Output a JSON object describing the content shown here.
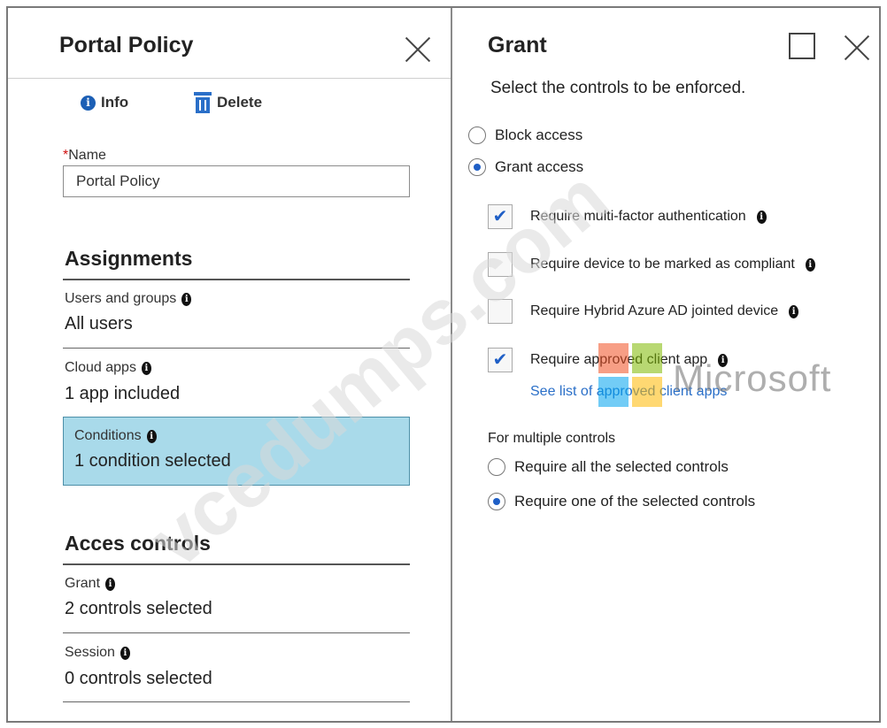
{
  "left": {
    "title": "Portal Policy",
    "toolbar": {
      "info_label": "Info",
      "delete_label": "Delete"
    },
    "name": {
      "required_mark": "*",
      "label": "Name",
      "value": "Portal Policy"
    },
    "assignments": {
      "title": "Assignments",
      "users_groups": {
        "label": "Users and groups",
        "value": "All users"
      },
      "cloud_apps": {
        "label": "Cloud apps",
        "value": "1 app included"
      },
      "conditions": {
        "label": "Conditions",
        "value": "1 condition selected"
      }
    },
    "access_controls": {
      "title": "Acces controls",
      "grant": {
        "label": "Grant",
        "value": "2 controls selected"
      },
      "session": {
        "label": "Session",
        "value": "0 controls selected"
      }
    }
  },
  "right": {
    "title": "Grant",
    "subtitle": "Select the controls to be enforced.",
    "access_options": [
      {
        "label": "Block access",
        "selected": false
      },
      {
        "label": "Grant access",
        "selected": true
      }
    ],
    "controls": [
      {
        "label": "Require multi-factor authentication",
        "checked": true
      },
      {
        "label": "Require device to be marked as compliant",
        "checked": false
      },
      {
        "label": "Require Hybrid Azure AD jointed device",
        "checked": false
      },
      {
        "label": "Require approved client app",
        "checked": true
      }
    ],
    "approved_apps_link": "See list of approved client apps",
    "multiple_controls": {
      "label": "For multiple controls",
      "options": [
        {
          "label": "Require all the selected controls",
          "selected": false
        },
        {
          "label": "Require one of the selected controls",
          "selected": true
        }
      ]
    }
  },
  "watermark": {
    "text": "vcedumps.com",
    "brand": "Microsoft"
  },
  "colors": {
    "accent": "#1f5fc6",
    "selected_row_bg": "#a9daea",
    "link": "#2a6fc8",
    "required": "#d01010"
  }
}
